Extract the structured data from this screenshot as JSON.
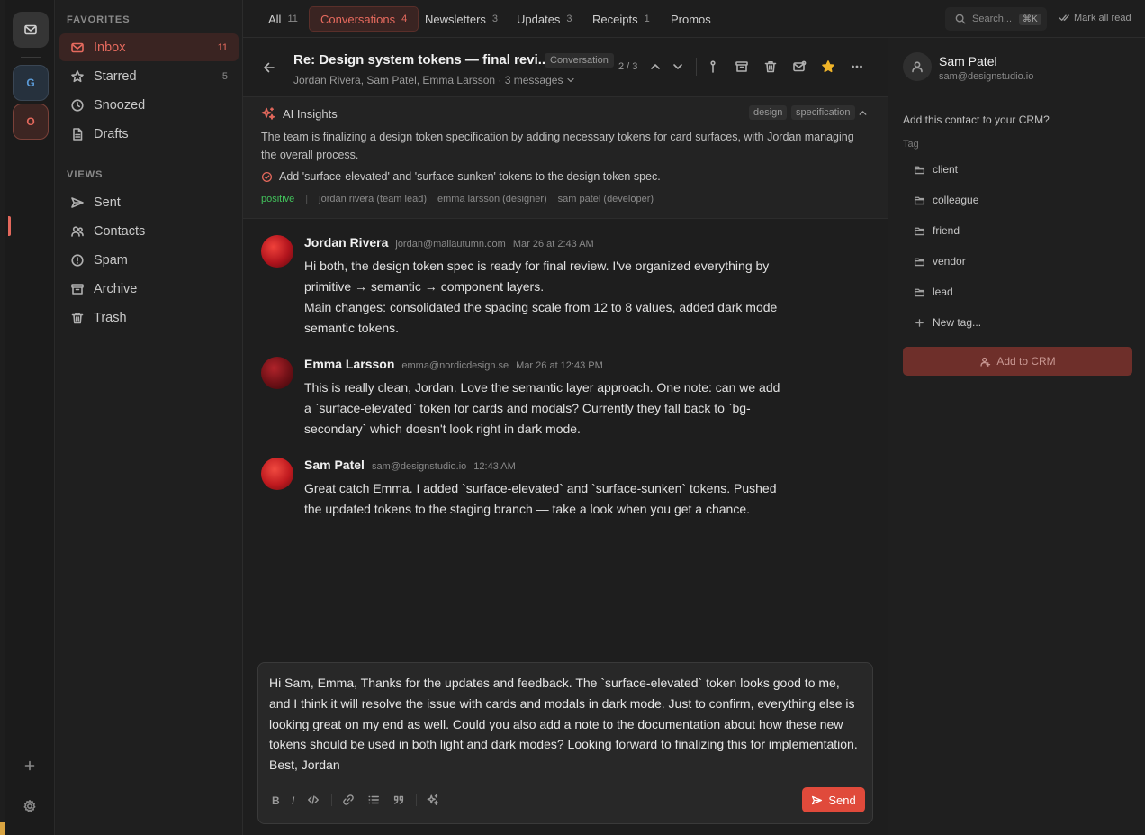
{
  "rail": {
    "accounts": [
      {
        "letter": "G",
        "color": "#5b9bd8"
      },
      {
        "letter": "O",
        "color": "#e3685c"
      }
    ]
  },
  "sidebar": {
    "favorites_heading": "FAVORITES",
    "views_heading": "VIEWS",
    "favorites": [
      {
        "label": "Inbox",
        "count": "11",
        "icon": "inbox-icon",
        "active": true
      },
      {
        "label": "Starred",
        "count": "5",
        "icon": "star-icon"
      },
      {
        "label": "Snoozed",
        "count": "",
        "icon": "clock-icon"
      },
      {
        "label": "Drafts",
        "count": "",
        "icon": "file-icon"
      }
    ],
    "views": [
      {
        "label": "Sent",
        "icon": "send-icon"
      },
      {
        "label": "Contacts",
        "icon": "users-icon"
      },
      {
        "label": "Spam",
        "icon": "alert-icon"
      },
      {
        "label": "Archive",
        "icon": "archive-icon"
      },
      {
        "label": "Trash",
        "icon": "trash-icon"
      }
    ]
  },
  "topbar": {
    "tabs": [
      {
        "label": "All",
        "count": "11"
      },
      {
        "label": "Conversations",
        "count": "4",
        "active": true
      },
      {
        "label": "Newsletters",
        "count": "3"
      },
      {
        "label": "Updates",
        "count": "3"
      },
      {
        "label": "Receipts",
        "count": "1"
      },
      {
        "label": "Promos",
        "count": ""
      }
    ],
    "search_placeholder": "Search...",
    "search_shortcut": "⌘K",
    "mark_all_read": "Mark all read"
  },
  "thread": {
    "title": "Re: Design system tokens — final revi...",
    "badge": "Conversation",
    "participants": "Jordan Rivera, Sam Patel, Emma Larsson · 3 messages",
    "pager": "2 / 3"
  },
  "ai_insights": {
    "title": "AI Insights",
    "tags": [
      "design",
      "specification"
    ],
    "summary": "The team is finalizing a design token specification by adding necessary tokens for card surfaces, with Jordan managing the overall process.",
    "action_item": "Add 'surface-elevated' and 'surface-sunken' tokens to the design token spec.",
    "sentiment": "positive",
    "sentiment_color": "#42c25b",
    "people": [
      "jordan rivera (team lead)",
      "emma larsson (designer)",
      "sam patel (developer)"
    ]
  },
  "messages": [
    {
      "name": "Jordan Rivera",
      "email": "jordan@mailautumn.com",
      "time": "Mar 26 at 2:43 AM",
      "lines": [
        "Hi both, the design token spec is ready for final review. I've organized everything by",
        "primitive → semantic → component layers.",
        "Main changes: consolidated the spacing scale from 12 to 8 values, added dark mode",
        "semantic tokens."
      ]
    },
    {
      "name": "Emma Larsson",
      "email": "emma@nordicdesign.se",
      "time": "Mar 26 at 12:43 PM",
      "lines": [
        "This is really clean, Jordan. Love the semantic layer approach. One note: can we add",
        "a `surface-elevated` token for cards and modals? Currently they fall back to `bg-",
        "secondary` which doesn't look right in dark mode."
      ]
    },
    {
      "name": "Sam Patel",
      "email": "sam@designstudio.io",
      "time": "12:43 AM",
      "lines": [
        "Great catch Emma. I added `surface-elevated` and `surface-sunken` tokens. Pushed",
        "the updated tokens to the staging branch — take a look when you get a chance."
      ]
    }
  ],
  "composer": {
    "lines": [
      "Hi Sam, Emma, Thanks for the updates and feedback. The `surface-elevated` token looks good to me,",
      "and I think it will resolve the issue with cards and modals in dark mode. Just to confirm, everything else is",
      "looking great on my end as well. Could you also add a note to the documentation about how these new",
      "tokens should be used in both light and dark modes? Looking forward to finalizing this for implementation.",
      "Best, Jordan"
    ],
    "bold_label": "B",
    "italic_label": "I",
    "send_label": "Send",
    "send_color": "#e04a3b"
  },
  "contact": {
    "name": "Sam Patel",
    "email": "sam@designstudio.io",
    "crm_question": "Add this contact to your CRM?",
    "tag_label": "Tag",
    "tags": [
      "client",
      "colleague",
      "friend",
      "vendor",
      "lead"
    ],
    "new_tag": "New tag...",
    "add_button": "Add to CRM"
  },
  "colors": {
    "accent": "#e3685c",
    "background": "#1e1e1e"
  }
}
